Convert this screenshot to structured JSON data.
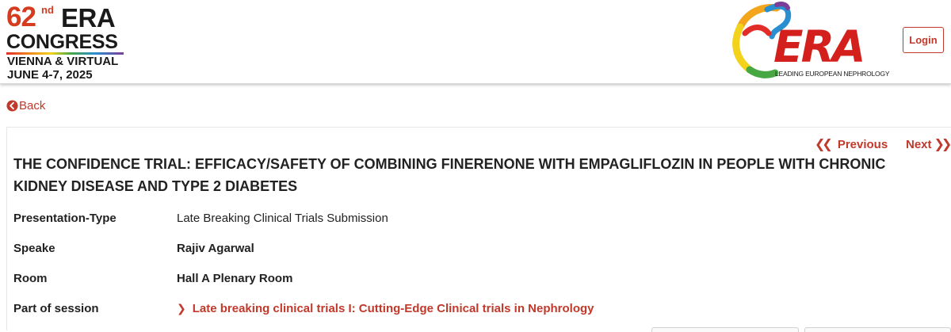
{
  "header": {
    "congress_logo": {
      "number": "62",
      "ordinal": "nd",
      "brand": "ERA",
      "word": "CONGRESS",
      "location": "VIENNA & VIRTUAL",
      "dates": "JUNE 4-7, 2025"
    },
    "era_logo": {
      "word": "ERA",
      "tagline": "LEADING EUROPEAN NEPHROLOGY"
    },
    "login_label": "Login"
  },
  "back_label": "Back",
  "pager": {
    "previous_label": "Previous",
    "next_label": "Next"
  },
  "talk": {
    "title": "THE CONFIDENCE TRIAL: EFFICACY/SAFETY OF COMBINING FINERENONE WITH EMPAGLIFLOZIN IN PEOPLE WITH CHRONIC KIDNEY DISEASE AND TYPE 2 DIABETES",
    "details": {
      "presentation_type_label": "Presentation-Type",
      "presentation_type_value": "Late Breaking Clinical Trials Submission",
      "speaker_label": "Speake",
      "speaker_value": "Rajiv Agarwal",
      "room_label": "Room",
      "room_value": "Hall A Plenary Room",
      "session_label": "Part of session",
      "session_value": "Late breaking clinical trials I: Cutting-Edge Clinical trials in Nephrology"
    }
  },
  "colors": {
    "accent": "#c0392b",
    "era_red": "#d4201c",
    "text": "#222222"
  },
  "icons": {
    "back": "circle-arrow-left-icon",
    "previous": "double-chevron-left-icon",
    "next": "double-chevron-right-icon",
    "session": "chevron-right-icon"
  }
}
